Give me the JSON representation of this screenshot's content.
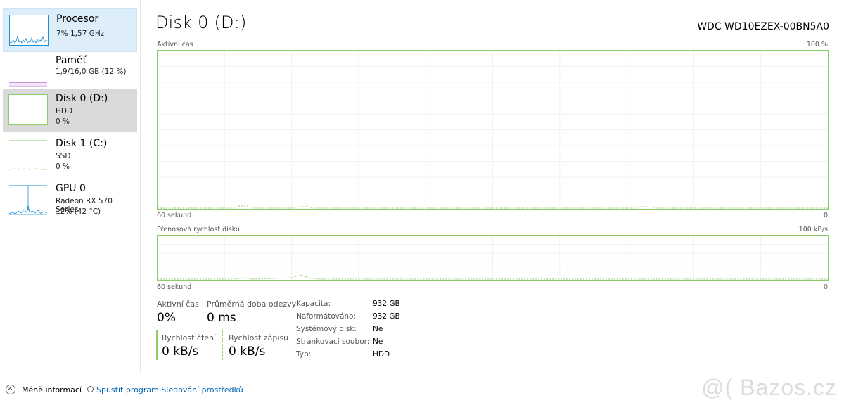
{
  "sidebar": {
    "items": [
      {
        "title": "Procesor",
        "line1": "7%  1,57 GHz",
        "line2": ""
      },
      {
        "title": "Paměť",
        "line1": "1,9/16,0 GB (12 %)",
        "line2": ""
      },
      {
        "title": "Disk 0 (D:)",
        "line1": "HDD",
        "line2": "0 %"
      },
      {
        "title": "Disk 1 (C:)",
        "line1": "SSD",
        "line2": "0 %"
      },
      {
        "title": "GPU 0",
        "line1": "Radeon RX 570 Series",
        "line2": "12%  (42 °C)"
      }
    ]
  },
  "header": {
    "title": "Disk 0 (D:)",
    "model": "WDC WD10EZEX-00BN5A0"
  },
  "graph1": {
    "label": "Aktivní čas",
    "max": "100 %",
    "xlabel": "60 sekund",
    "min": "0"
  },
  "graph2": {
    "label": "Přenosová rychlost disku",
    "max": "100 kB/s",
    "xlabel": "60 sekund",
    "min": "0"
  },
  "stats": {
    "active_time_label": "Aktivní čas",
    "active_time_value": "0%",
    "response_label": "Průměrná doba odezvy",
    "response_value": "0 ms",
    "read_label": "Rychlost čtení",
    "read_value": "0 kB/s",
    "write_label": "Rychlost zápisu",
    "write_value": "0 kB/s"
  },
  "properties": [
    {
      "label": "Kapacita:",
      "value": "932 GB"
    },
    {
      "label": "Naformátováno:",
      "value": "932 GB"
    },
    {
      "label": "Systémový disk:",
      "value": "Ne"
    },
    {
      "label": "Stránkovací soubor:",
      "value": "Ne"
    },
    {
      "label": "Typ:",
      "value": "HDD"
    }
  ],
  "footer": {
    "less_info": "Méně informací",
    "open_monitor": "Spustit program Sledování prostředků"
  },
  "watermark": "@( Bazos.cz",
  "colors": {
    "disk": "#8ccd6a",
    "cpu": "#1f8fd4",
    "memory": "#a83fc6",
    "link": "#0063b1",
    "selected": "#d9d9d9"
  }
}
